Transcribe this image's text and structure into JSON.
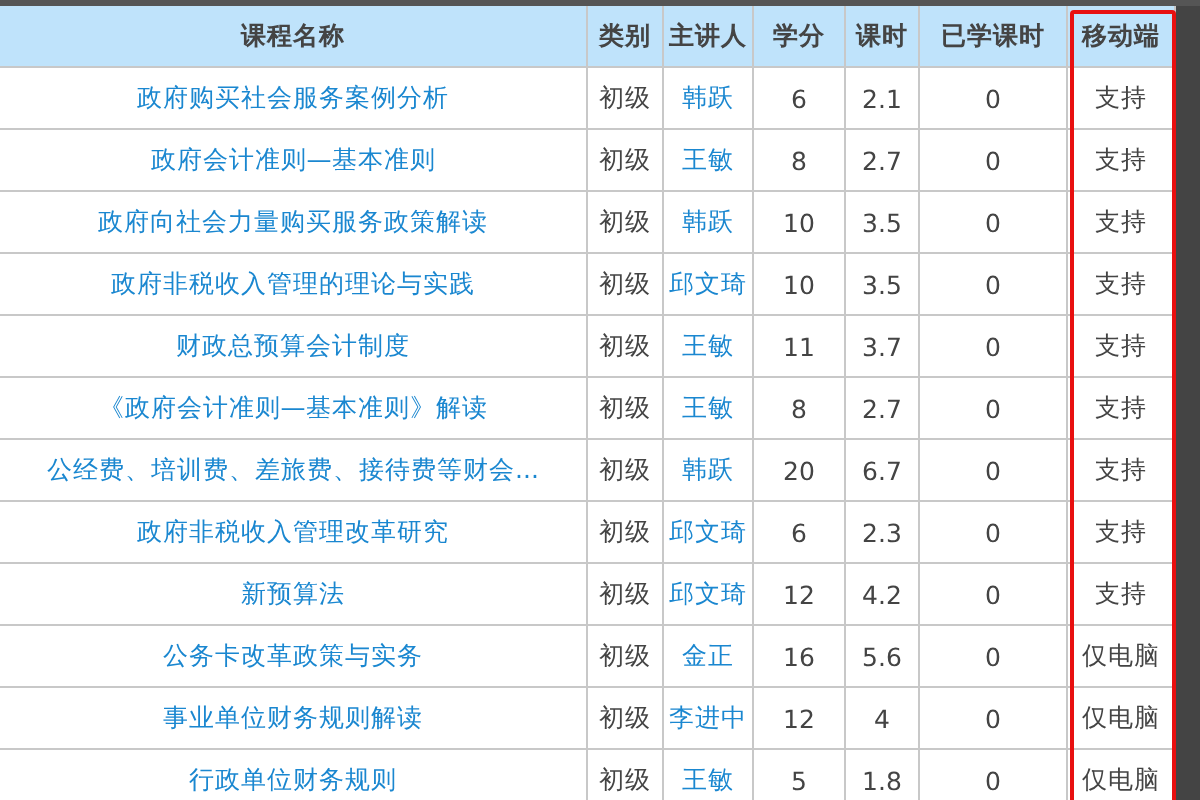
{
  "table": {
    "columns": [
      {
        "label": "课程名称",
        "highlighted": false
      },
      {
        "label": "类别",
        "highlighted": false
      },
      {
        "label": "主讲人",
        "highlighted": false
      },
      {
        "label": "学分",
        "highlighted": false
      },
      {
        "label": "课时",
        "highlighted": false
      },
      {
        "label": "已学课时",
        "highlighted": false
      },
      {
        "label": "移动端",
        "highlighted": true
      }
    ],
    "rows": [
      [
        "政府购买社会服务案例分析",
        "初级",
        "韩跃",
        "6",
        "2.1",
        "0",
        "支持"
      ],
      [
        "政府会计准则—基本准则",
        "初级",
        "王敏",
        "8",
        "2.7",
        "0",
        "支持"
      ],
      [
        "政府向社会力量购买服务政策解读",
        "初级",
        "韩跃",
        "10",
        "3.5",
        "0",
        "支持"
      ],
      [
        "政府非税收入管理的理论与实践",
        "初级",
        "邱文琦",
        "10",
        "3.5",
        "0",
        "支持"
      ],
      [
        "财政总预算会计制度",
        "初级",
        "王敏",
        "11",
        "3.7",
        "0",
        "支持"
      ],
      [
        "《政府会计准则—基本准则》解读",
        "初级",
        "王敏",
        "8",
        "2.7",
        "0",
        "支持"
      ],
      [
        "公经费、培训费、差旅费、接待费等财会...",
        "初级",
        "韩跃",
        "20",
        "6.7",
        "0",
        "支持"
      ],
      [
        "政府非税收入管理改革研究",
        "初级",
        "邱文琦",
        "6",
        "2.3",
        "0",
        "支持"
      ],
      [
        "新预算法",
        "初级",
        "邱文琦",
        "12",
        "4.2",
        "0",
        "支持"
      ],
      [
        "公务卡改革政策与实务",
        "初级",
        "金正",
        "16",
        "5.6",
        "0",
        "仅电脑"
      ],
      [
        "事业单位财务规则解读",
        "初级",
        "李进中",
        "12",
        "4",
        "0",
        "仅电脑"
      ],
      [
        "行政单位财务规则",
        "初级",
        "王敏",
        "5",
        "1.8",
        "0",
        "仅电脑"
      ]
    ]
  }
}
